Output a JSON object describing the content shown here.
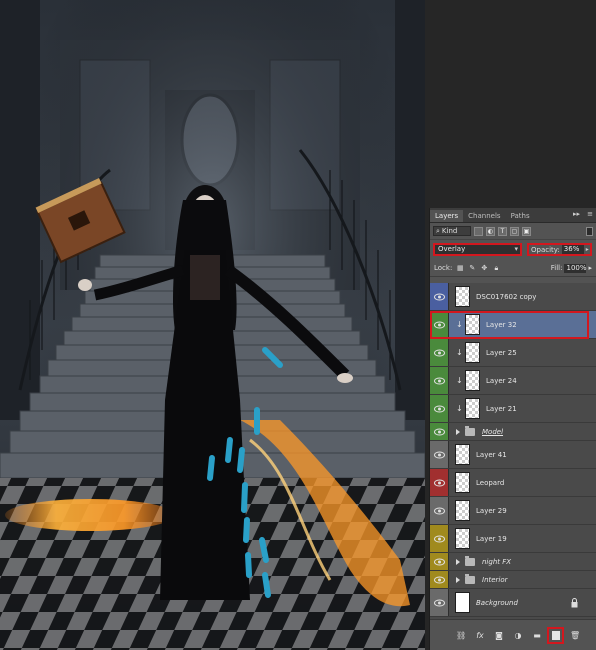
{
  "panel": {
    "tabs": [
      {
        "label": "Layers",
        "active": true
      },
      {
        "label": "Channels",
        "active": false
      },
      {
        "label": "Paths",
        "active": false
      }
    ],
    "more_icon": "▸▸",
    "menu_icon": "≡",
    "filter_kind": "Kind",
    "filter_icons": [
      "image-filter-icon",
      "adjustment-filter-icon",
      "type-filter-icon",
      "shape-filter-icon",
      "smart-object-filter-icon"
    ],
    "blend_mode": "Overlay",
    "opacity_label": "Opacity:",
    "opacity_value": "36%",
    "lock_label": "Lock:",
    "fill_label": "Fill:",
    "fill_value": "100%"
  },
  "layers": [
    {
      "name": "DSC017602 copy",
      "label_color": "#4a5fa0",
      "type": "layer",
      "selected": false,
      "clipped": false
    },
    {
      "name": "Layer 32",
      "label_color": "#4a8a3c",
      "type": "layer",
      "selected": true,
      "clipped": true
    },
    {
      "name": "Layer 25",
      "label_color": "#4a8a3c",
      "type": "layer",
      "selected": false,
      "clipped": true
    },
    {
      "name": "Layer 24",
      "label_color": "#4a8a3c",
      "type": "layer",
      "selected": false,
      "clipped": true
    },
    {
      "name": "Layer 21",
      "label_color": "#4a8a3c",
      "type": "layer",
      "selected": false,
      "clipped": true
    },
    {
      "name": "Model",
      "label_color": "#4a8a3c",
      "type": "group",
      "selected": false,
      "clipped": false
    },
    {
      "name": "Layer 41",
      "label_color": "#6a6a6a",
      "type": "layer",
      "selected": false,
      "clipped": false
    },
    {
      "name": "Leopard",
      "label_color": "#a12f2f",
      "type": "layer",
      "selected": false,
      "clipped": false
    },
    {
      "name": "Layer 29",
      "label_color": "#6a6a6a",
      "type": "layer",
      "selected": false,
      "clipped": false
    },
    {
      "name": "Layer 19",
      "label_color": "#a08a1e",
      "type": "layer",
      "selected": false,
      "clipped": false
    },
    {
      "name": "night FX",
      "label_color": "#a08a1e",
      "type": "group",
      "selected": false,
      "clipped": false
    },
    {
      "name": "Interior",
      "label_color": "#a08a1e",
      "type": "group",
      "selected": false,
      "clipped": false
    },
    {
      "name": "Background",
      "label_color": "#6a6a6a",
      "type": "background",
      "selected": false,
      "clipped": false
    }
  ],
  "footer_icons": [
    "link-layers-icon",
    "fx-icon",
    "add-mask-icon",
    "adjustment-layer-icon",
    "new-group-icon",
    "new-layer-icon",
    "delete-layer-icon"
  ],
  "colors": {
    "highlight": "#d3171e",
    "selection": "#5a6f96",
    "panel_bg": "#535353"
  }
}
